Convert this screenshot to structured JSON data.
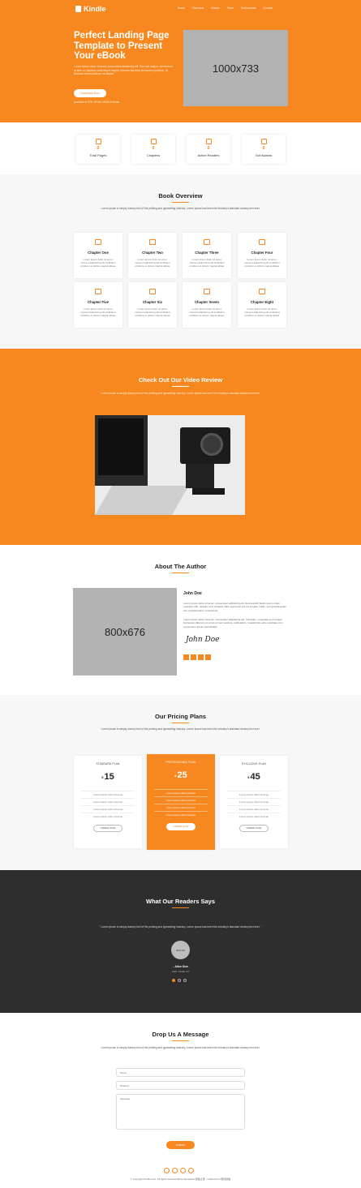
{
  "brand": {
    "name": "Kindle",
    "accent": "#f7881f",
    "dark": "#2e2e2e"
  },
  "nav": {
    "items": [
      "Home",
      "Overview",
      "Events",
      "Team",
      "Testimonials",
      "Contact"
    ]
  },
  "hero": {
    "title": "Perfect Landing Page Template to Present Your eBook",
    "description": "Lorem ipsum dolor sit amet, consectetur adipiscing elit. Sed nisl magna, fermentum at ante ut, dapibus scelerisque magna. Aenean faucibus fermentum pulvinar. Ut tincidunt lorem pulvinar mi aliquet.",
    "button_label": "Download Now",
    "note": "Available in PDF, EPUB, MOBI & Kindle",
    "image_placeholder": "1000x733"
  },
  "stats": [
    {
      "icon": "book-icon",
      "value": "0",
      "label": "Total Pages"
    },
    {
      "icon": "bookmark-icon",
      "value": "0",
      "label": "Chapters"
    },
    {
      "icon": "users-icon",
      "value": "0",
      "label": "Active Readers"
    },
    {
      "icon": "trophy-icon",
      "value": "0",
      "label": "Got Awards"
    }
  ],
  "overview": {
    "title": "Book Overview",
    "description": "Lorem Ipsum is simply dummy text of the printing and typesetting industry. Lorem Ipsum has been the industry's standard dummy text ever.",
    "chapter_desc": "Lorem ipsum dolor sit amet, consect adipisicing elit incididunt ut labore et dolore magna aliqua.",
    "chapters": [
      {
        "icon": "folder-icon",
        "name": "Chapter One"
      },
      {
        "icon": "image-icon",
        "name": "Chapter Two"
      },
      {
        "icon": "layers-icon",
        "name": "Chapter Three"
      },
      {
        "icon": "copy-icon",
        "name": "Chapter Four"
      },
      {
        "icon": "document-icon",
        "name": "Chapter Five"
      },
      {
        "icon": "crop-icon",
        "name": "Chapter Six"
      },
      {
        "icon": "monitor-icon",
        "name": "Chapter Seven"
      },
      {
        "icon": "notes-icon",
        "name": "Chapter Eight"
      }
    ]
  },
  "video": {
    "title": "Check Out Our Video Review",
    "description": "Lorem Ipsum is simply dummy text of the printing and typesetting industry. Lorem Ipsum has been the industry's standard dummy text ever."
  },
  "author": {
    "title": "About The Author",
    "name": "John Doe",
    "bio_1": "Lorem ipsum dolor sit amet, consectetur adipiscing elit. Sed suscipit facilis ipsum etiam molestie nibh, aliquam erat volutpat. Nam eget justo dui vel congue mollis, sed gravida quam nisi, reprehenderit, consectetur.",
    "bio_2": "Lorem ipsum dolor sit amet, consectetur adipisicing elit. Voluptate, molestiae et at neque! Numquam laborum ut omnis et sed nesciunt, quibusdam, repellendus odio cupiditate cum consectetur ipsum perspiciatis.",
    "signature": "John Doe",
    "image_placeholder": "800x676",
    "social": [
      "facebook-icon",
      "twitter-icon",
      "linkedin-icon",
      "google-plus-icon"
    ]
  },
  "pricing": {
    "title": "Our Pricing Plans",
    "description": "Lorem Ipsum is simply dummy text of the printing and typesetting industry. Lorem Ipsum has been the industry's standard dummy text ever.",
    "currency": "$",
    "feature_text": "Lorem ipsum dolor sit amet",
    "button_label": "ORDER NOW",
    "plans": [
      {
        "name": "STANDARD PLAN",
        "price": "15"
      },
      {
        "name": "PROFESSIONAL PLAN",
        "price": "25"
      },
      {
        "name": "EXCLUSIVE PLAN",
        "price": "45"
      }
    ]
  },
  "testimonial": {
    "title": "What Our Readers Says",
    "quote": "\" Lorem Ipsum is simply dummy text of the printing and typesetting industry. Lorem Ipsum has been the industry's standard dummy text ever. \"",
    "avatar_placeholder": "100x100",
    "name": "- Alice Doe",
    "role": "CEO, Kindle Inc"
  },
  "contact": {
    "title": "Drop Us A Message",
    "description": "Lorem Ipsum is simply dummy text of the printing and typesetting industry. Lorem Ipsum has been the industry's standard dummy text ever.",
    "name_placeholder": "Name",
    "email_placeholder": "Email Id",
    "message_placeholder": "Message",
    "button_label": "SUBMIT"
  },
  "footer": {
    "social": [
      "facebook-icon",
      "twitter-icon",
      "linkedin-icon",
      "google-plus-icon"
    ],
    "copyright": "© Copyright Kindle.com. All rights reserved More Templates 模板之家 - Collect from 网页模板"
  }
}
